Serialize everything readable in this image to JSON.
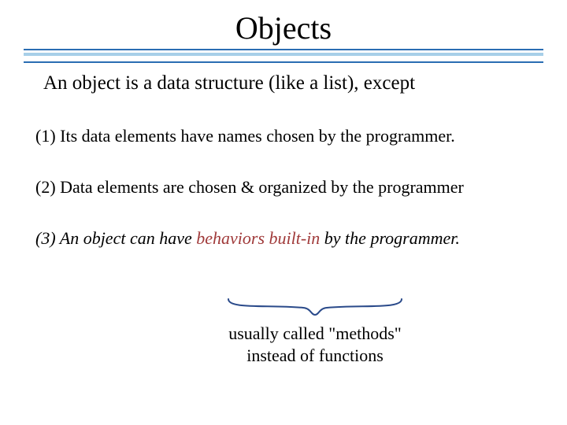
{
  "title": "Objects",
  "intro": "An object is a data structure (like a list), except",
  "points": {
    "p1": "(1) Its data elements have names chosen by the programmer.",
    "p2": "(2) Data elements are chosen & organized by the programmer",
    "p3_a": "(3) An object can have ",
    "p3_b": "behaviors built-in",
    "p3_c": " by the programmer."
  },
  "note_line1": "usually called \"methods\"",
  "note_line2": "instead of functions",
  "colors": {
    "rule_border": "#2a6db3",
    "rule_fill": "#a7cfe8",
    "emphasis": "#a03a3a"
  }
}
